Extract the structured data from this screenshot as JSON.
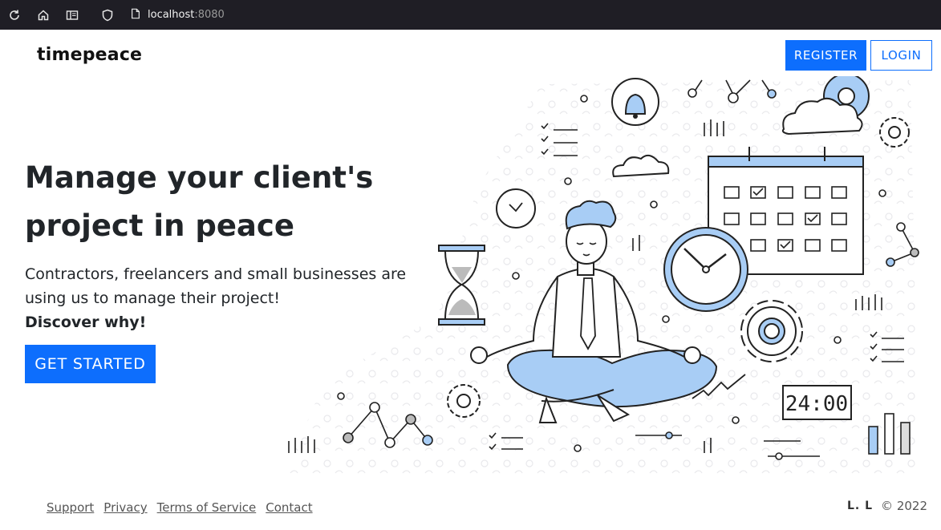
{
  "browser": {
    "url_host": "localhost",
    "url_port": ":8080",
    "icons": [
      "reload-icon",
      "home-icon",
      "reader-view-icon",
      "shield-icon",
      "page-icon"
    ]
  },
  "header": {
    "brand": "timepeace",
    "register_label": "REGISTER",
    "login_label": "LOGIN"
  },
  "hero": {
    "title_line1": "Manage your client's",
    "title_line2": "project in peace",
    "subtitle": "Contractors, freelancers and small businesses are using us to manage their project!",
    "emphasis": "Discover why!",
    "cta_label": "GET STARTED"
  },
  "illustration": {
    "clock_display": "24:00"
  },
  "footer": {
    "links": [
      "Support",
      "Privacy",
      "Terms of Service",
      "Contact"
    ],
    "logo_text": "L. L",
    "copyright": "© 2022"
  },
  "colors": {
    "primary": "#0d6efd",
    "chrome_bg": "#1f1e25",
    "illustration_blue": "#a8cdf5"
  }
}
